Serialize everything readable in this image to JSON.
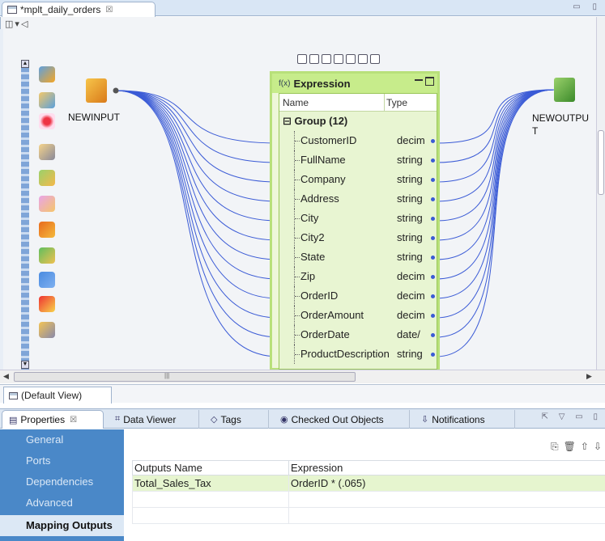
{
  "editor": {
    "tab_title": "*mplt_daily_orders",
    "tab_close": "☒",
    "window_btns": "▭ ▯"
  },
  "canvas": {
    "mini_toolbar": [
      "◫",
      "▾",
      "◁"
    ],
    "input_node": {
      "label": "NEWINPUT"
    },
    "output_node": {
      "label": "NEWOUTPU\nT",
      "label_line1": "NEWOUTPU",
      "label_line2": "T"
    }
  },
  "expression": {
    "title": "Expression",
    "fx": "f(x)",
    "columns": {
      "name": "Name",
      "type": "Type"
    },
    "group_label": "Group (12)",
    "group_toggle": "⊟",
    "ports": [
      {
        "name": "CustomerID",
        "type": "decim"
      },
      {
        "name": "FullName",
        "type": "string"
      },
      {
        "name": "Company",
        "type": "string"
      },
      {
        "name": "Address",
        "type": "string"
      },
      {
        "name": "City",
        "type": "string"
      },
      {
        "name": "City2",
        "type": "string"
      },
      {
        "name": "State",
        "type": "string"
      },
      {
        "name": "Zip",
        "type": "decim"
      },
      {
        "name": "OrderID",
        "type": "decim"
      },
      {
        "name": "OrderAmount",
        "type": "decim"
      },
      {
        "name": "OrderDate",
        "type": "date/"
      },
      {
        "name": "ProductDescription",
        "type": "string"
      }
    ]
  },
  "view_tab": {
    "label": "(Default View)"
  },
  "properties_tabs": [
    {
      "label": "Properties",
      "icon": "▤",
      "active": true
    },
    {
      "label": "Data Viewer",
      "icon": "⌗",
      "active": false
    },
    {
      "label": "Tags",
      "icon": "◇",
      "active": false
    },
    {
      "label": "Checked Out Objects",
      "icon": "◉",
      "active": false
    },
    {
      "label": "Notifications",
      "icon": "⇩",
      "active": false
    }
  ],
  "properties_tab_close": "☒",
  "side_nav": [
    {
      "label": "General",
      "selected": false
    },
    {
      "label": "Ports",
      "selected": false
    },
    {
      "label": "Dependencies",
      "selected": false
    },
    {
      "label": "Advanced",
      "selected": false
    },
    {
      "label": "Mapping Outputs",
      "selected": true
    }
  ],
  "outputs_table": {
    "headers": [
      "Outputs Name",
      "Expression"
    ],
    "rows": [
      [
        "Total_Sales_Tax",
        "OrderID * (.065)"
      ],
      [
        "",
        ""
      ],
      [
        "",
        ""
      ]
    ]
  },
  "colors": {
    "accent_green": "#b8e07a",
    "side_nav_blue": "#4a88c8",
    "wire_blue": "#3b5bd6"
  }
}
